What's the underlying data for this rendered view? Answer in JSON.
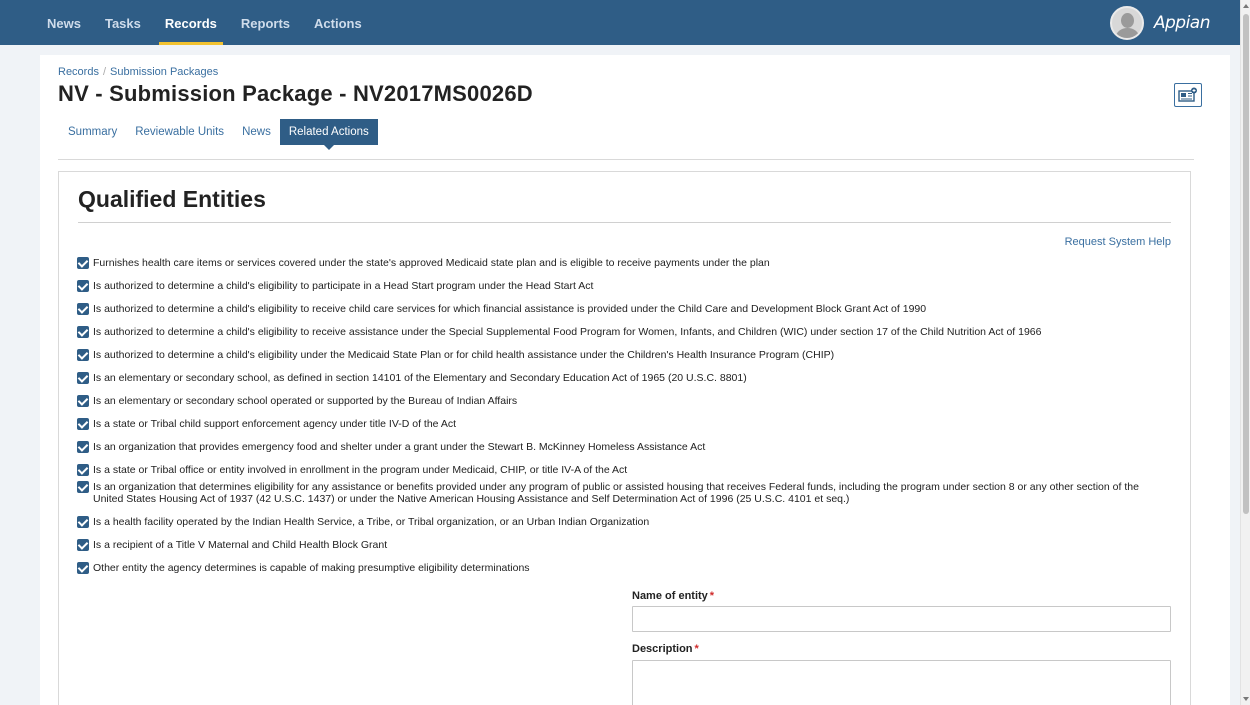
{
  "nav": {
    "items": [
      {
        "label": "News",
        "active": false
      },
      {
        "label": "Tasks",
        "active": false
      },
      {
        "label": "Records",
        "active": true
      },
      {
        "label": "Reports",
        "active": false
      },
      {
        "label": "Actions",
        "active": false
      }
    ],
    "brand": "Appian"
  },
  "breadcrumb": {
    "root": "Records",
    "separator": "/",
    "current": "Submission Packages"
  },
  "page_title": "NV - Submission Package - NV2017MS0026D",
  "tabs": [
    {
      "label": "Summary",
      "active": false
    },
    {
      "label": "Reviewable Units",
      "active": false
    },
    {
      "label": "News",
      "active": false
    },
    {
      "label": "Related Actions",
      "active": true
    }
  ],
  "section": {
    "title": "Qualified Entities",
    "help_link": "Request System Help"
  },
  "checklist": [
    {
      "checked": true,
      "text": "Furnishes health care items or services covered under the state's approved Medicaid state plan and is eligible to receive payments under the plan"
    },
    {
      "checked": true,
      "text": "Is authorized to determine a child's eligibility to participate in a Head Start program under the Head Start Act"
    },
    {
      "checked": true,
      "text": "Is authorized to determine a child's eligibility to receive child care services for which financial assistance is provided under the Child Care and Development Block Grant Act of 1990"
    },
    {
      "checked": true,
      "text": "Is authorized to determine a child's eligibility to receive assistance under the Special Supplemental Food Program for Women, Infants, and Children (WIC) under section 17 of the Child Nutrition Act of 1966"
    },
    {
      "checked": true,
      "text": "Is authorized to determine a child's eligibility under the Medicaid State Plan or for child health assistance under the Children's Health Insurance Program (CHIP)"
    },
    {
      "checked": true,
      "text": "Is an elementary or secondary school, as defined in section 14101 of the Elementary and Secondary Education Act of 1965 (20 U.S.C. 8801)"
    },
    {
      "checked": true,
      "text": "Is an elementary or secondary school operated or supported by the Bureau of Indian Affairs"
    },
    {
      "checked": true,
      "text": "Is a state or Tribal child support enforcement agency under title IV-D of the Act"
    },
    {
      "checked": true,
      "text": "Is an organization that provides emergency food and shelter under a grant under the Stewart B. McKinney Homeless Assistance Act"
    },
    {
      "checked": true,
      "text": "Is a state or Tribal office or entity involved in enrollment in the program under Medicaid, CHIP, or title IV-A of the Act"
    },
    {
      "checked": true,
      "text": "Is an organization that determines eligibility for any assistance or benefits provided under any program of public or assisted housing that receives Federal funds, including the program under section 8 or any other section of the United States Housing Act of 1937 (42 U.S.C. 1437) or under the Native American Housing Assistance and Self Determination Act of 1996 (25 U.S.C. 4101 et seq.)"
    },
    {
      "checked": true,
      "text": "Is a health facility operated by the Indian Health Service, a Tribe, or Tribal organization, or an Urban Indian Organization"
    },
    {
      "checked": true,
      "text": "Is a recipient of a Title V Maternal and Child Health Block Grant"
    },
    {
      "checked": true,
      "text": "Other entity the agency determines is capable of making presumptive eligibility determinations"
    }
  ],
  "form": {
    "name_label": "Name of entity",
    "name_value": "",
    "description_label": "Description",
    "description_value": "",
    "required_marker": "*"
  },
  "colors": {
    "nav_bg": "#2f5d86",
    "active_underline": "#f2c230",
    "link": "#3a6fa0",
    "required": "#d02b2b"
  }
}
